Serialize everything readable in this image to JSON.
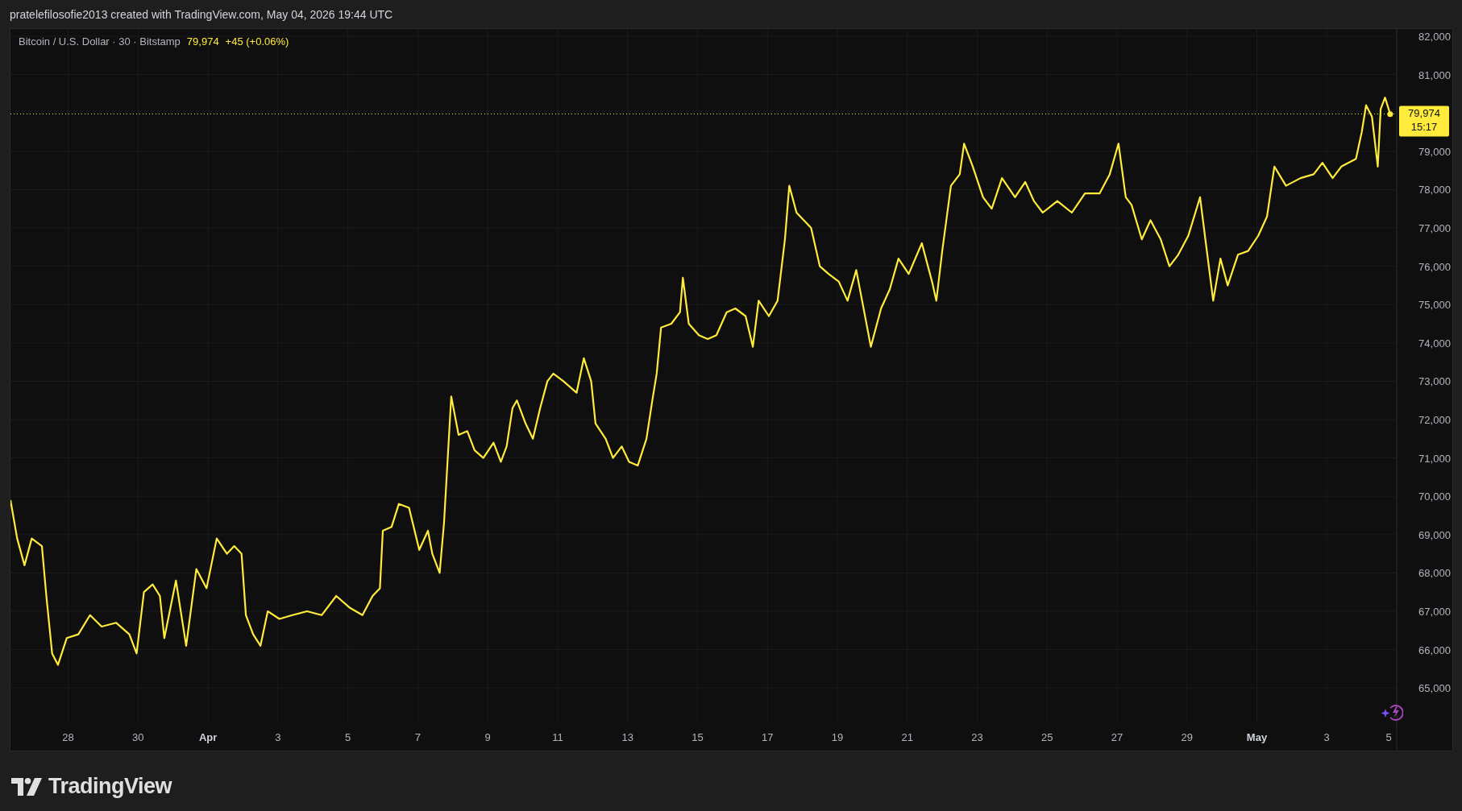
{
  "header": {
    "text": "pratelefilosofie2013 created with TradingView.com, May 04, 2026 19:44 UTC"
  },
  "legend": {
    "symbol": "Bitcoin / U.S. Dollar · 30 · Bitstamp",
    "price": "79,974",
    "change": "+45 (+0.06%)"
  },
  "price_tag": {
    "countdown": "15:17"
  },
  "chart_data": {
    "type": "line",
    "grid": true,
    "xlim": [
      "2026-03-26T08:24",
      "2026-05-05T00:00"
    ],
    "ylim": [
      64080,
      82189
    ],
    "ref_lines": [
      {
        "axis": "y",
        "value": 79974,
        "label": "79,974",
        "color": "#ffeb3b"
      }
    ],
    "yticks": [
      {
        "value": 65000,
        "label": "65,000"
      },
      {
        "value": 66000,
        "label": "66,000"
      },
      {
        "value": 67000,
        "label": "67,000"
      },
      {
        "value": 68000,
        "label": "68,000"
      },
      {
        "value": 69000,
        "label": "69,000"
      },
      {
        "value": 70000,
        "label": "70,000"
      },
      {
        "value": 71000,
        "label": "71,000"
      },
      {
        "value": 72000,
        "label": "72,000"
      },
      {
        "value": 73000,
        "label": "73,000"
      },
      {
        "value": 74000,
        "label": "74,000"
      },
      {
        "value": 75000,
        "label": "75,000"
      },
      {
        "value": 76000,
        "label": "76,000"
      },
      {
        "value": 77000,
        "label": "77,000"
      },
      {
        "value": 78000,
        "label": "78,000"
      },
      {
        "value": 79000,
        "label": "79,000"
      },
      {
        "value": 81000,
        "label": "81,000"
      },
      {
        "value": 82000,
        "label": "82,000"
      }
    ],
    "xticks": [
      {
        "value": "2026-03-28",
        "label": "28"
      },
      {
        "value": "2026-03-30",
        "label": "30"
      },
      {
        "value": "2026-04-01",
        "label": "Apr"
      },
      {
        "value": "2026-04-03",
        "label": "3"
      },
      {
        "value": "2026-04-05",
        "label": "5"
      },
      {
        "value": "2026-04-07",
        "label": "7"
      },
      {
        "value": "2026-04-09",
        "label": "9"
      },
      {
        "value": "2026-04-11",
        "label": "11"
      },
      {
        "value": "2026-04-13",
        "label": "13"
      },
      {
        "value": "2026-04-15",
        "label": "15"
      },
      {
        "value": "2026-04-17",
        "label": "17"
      },
      {
        "value": "2026-04-19",
        "label": "19"
      },
      {
        "value": "2026-04-21",
        "label": "21"
      },
      {
        "value": "2026-04-23",
        "label": "23"
      },
      {
        "value": "2026-04-25",
        "label": "25"
      },
      {
        "value": "2026-04-27",
        "label": "27"
      },
      {
        "value": "2026-04-29",
        "label": "29"
      },
      {
        "value": "2026-05-01",
        "label": "May"
      },
      {
        "value": "2026-05-03",
        "label": "3"
      },
      {
        "value": "2026-05-05",
        "label": "5"
      }
    ],
    "x": [
      "2026-03-26T08:24",
      "2026-03-26T13:00",
      "2026-03-26T18:00",
      "2026-03-26T23:00",
      "2026-03-27T06:00",
      "2026-03-27T09:00",
      "2026-03-27T13:00",
      "2026-03-27T17:00",
      "2026-03-27T23:00",
      "2026-03-28T07:00",
      "2026-03-28T15:00",
      "2026-03-28T23:00",
      "2026-03-29T09:00",
      "2026-03-29T18:00",
      "2026-03-29T23:00",
      "2026-03-30T04:00",
      "2026-03-30T10:00",
      "2026-03-30T15:00",
      "2026-03-30T18:00",
      "2026-03-31T02:00",
      "2026-03-31T09:00",
      "2026-03-31T16:00",
      "2026-03-31T23:00",
      "2026-04-01T06:00",
      "2026-04-01T13:00",
      "2026-04-01T18:00",
      "2026-04-01T23:00",
      "2026-04-02T02:00",
      "2026-04-02T07:00",
      "2026-04-02T12:00",
      "2026-04-02T17:00",
      "2026-04-03T01:00",
      "2026-04-03T10:00",
      "2026-04-03T20:00",
      "2026-04-04T06:00",
      "2026-04-04T16:00",
      "2026-04-05T01:00",
      "2026-04-05T10:00",
      "2026-04-05T17:00",
      "2026-04-05T22:00",
      "2026-04-06T00:00",
      "2026-04-06T06:00",
      "2026-04-06T11:00",
      "2026-04-06T18:00",
      "2026-04-07T01:00",
      "2026-04-07T07:00",
      "2026-04-07T10:00",
      "2026-04-07T15:00",
      "2026-04-07T18:00",
      "2026-04-07T23:00",
      "2026-04-08T04:00",
      "2026-04-08T10:00",
      "2026-04-08T15:00",
      "2026-04-08T21:00",
      "2026-04-09T04:00",
      "2026-04-09T09:00",
      "2026-04-09T13:00",
      "2026-04-09T17:00",
      "2026-04-09T20:00",
      "2026-04-10T02:00",
      "2026-04-10T07:00",
      "2026-04-10T12:00",
      "2026-04-10T17:00",
      "2026-04-10T21:00",
      "2026-04-11T04:00",
      "2026-04-11T13:00",
      "2026-04-11T18:00",
      "2026-04-11T23:00",
      "2026-04-12T02:00",
      "2026-04-12T09:00",
      "2026-04-12T14:00",
      "2026-04-12T20:00",
      "2026-04-13T01:00",
      "2026-04-13T07:00",
      "2026-04-13T13:00",
      "2026-04-13T17:00",
      "2026-04-13T20:00",
      "2026-04-13T23:00",
      "2026-04-14T06:00",
      "2026-04-14T12:00",
      "2026-04-14T14:00",
      "2026-04-14T18:00",
      "2026-04-15T01:00",
      "2026-04-15T07:00",
      "2026-04-15T13:00",
      "2026-04-15T20:00",
      "2026-04-16T02:00",
      "2026-04-16T09:00",
      "2026-04-16T14:00",
      "2026-04-16T18:00",
      "2026-04-17T01:00",
      "2026-04-17T07:00",
      "2026-04-17T12:00",
      "2026-04-17T15:00",
      "2026-04-17T20:00",
      "2026-04-18T06:00",
      "2026-04-18T12:00",
      "2026-04-18T18:00",
      "2026-04-19T01:00",
      "2026-04-19T07:00",
      "2026-04-19T13:00",
      "2026-04-19T18:00",
      "2026-04-19T23:00",
      "2026-04-20T06:00",
      "2026-04-20T12:00",
      "2026-04-20T18:00",
      "2026-04-21T01:00",
      "2026-04-21T10:00",
      "2026-04-21T17:00",
      "2026-04-21T20:00",
      "2026-04-22T00:00",
      "2026-04-22T06:00",
      "2026-04-22T12:00",
      "2026-04-22T15:00",
      "2026-04-22T21:00",
      "2026-04-23T04:00",
      "2026-04-23T10:00",
      "2026-04-23T17:00",
      "2026-04-24T02:00",
      "2026-04-24T09:00",
      "2026-04-24T15:00",
      "2026-04-24T21:00",
      "2026-04-25T07:00",
      "2026-04-25T17:00",
      "2026-04-26T02:00",
      "2026-04-26T12:00",
      "2026-04-26T19:00",
      "2026-04-27T01:00",
      "2026-04-27T06:00",
      "2026-04-27T10:00",
      "2026-04-27T17:00",
      "2026-04-27T23:00",
      "2026-04-28T06:00",
      "2026-04-28T12:00",
      "2026-04-28T18:00",
      "2026-04-29T01:00",
      "2026-04-29T09:00",
      "2026-04-29T13:00",
      "2026-04-29T18:00",
      "2026-04-29T23:00",
      "2026-04-30T04:00",
      "2026-04-30T11:00",
      "2026-04-30T18:00",
      "2026-05-01T01:00",
      "2026-05-01T07:00",
      "2026-05-01T12:00",
      "2026-05-01T20:00",
      "2026-05-02T06:00",
      "2026-05-02T15:00",
      "2026-05-02T21:00",
      "2026-05-03T04:00",
      "2026-05-03T10:00",
      "2026-05-03T20:00",
      "2026-05-04T00:00",
      "2026-05-04T03:00",
      "2026-05-04T07:00",
      "2026-05-04T11:00",
      "2026-05-04T13:00",
      "2026-05-04T16:00",
      "2026-05-04T19:30"
    ],
    "series": [
      {
        "color": "#ffeb3b",
        "values": [
          69900,
          68900,
          68200,
          68900,
          68700,
          67400,
          65900,
          65600,
          66300,
          66400,
          66900,
          66600,
          66700,
          66400,
          65900,
          67500,
          67700,
          67400,
          66300,
          67800,
          66100,
          68100,
          67600,
          68900,
          68500,
          68700,
          68500,
          66900,
          66400,
          66100,
          67000,
          66800,
          66900,
          67000,
          66900,
          67400,
          67100,
          66900,
          67400,
          67600,
          69100,
          69200,
          69800,
          69700,
          68600,
          69100,
          68500,
          68000,
          69300,
          72600,
          71600,
          71700,
          71200,
          71000,
          71400,
          70900,
          71300,
          72300,
          72500,
          71900,
          71500,
          72300,
          73000,
          73200,
          73000,
          72700,
          73600,
          73000,
          71900,
          71500,
          71000,
          71300,
          70900,
          70800,
          71500,
          72500,
          73200,
          74400,
          74500,
          74800,
          75700,
          74500,
          74200,
          74100,
          74200,
          74800,
          74900,
          74700,
          73900,
          75100,
          74700,
          75100,
          76700,
          78100,
          77400,
          77000,
          76000,
          75800,
          75600,
          75100,
          75900,
          74900,
          73900,
          74900,
          75400,
          76200,
          75800,
          76600,
          75600,
          75100,
          76400,
          78100,
          78400,
          79200,
          78600,
          77800,
          77500,
          78300,
          77800,
          78200,
          77700,
          77400,
          77700,
          77400,
          77900,
          77900,
          78400,
          79200,
          77800,
          77600,
          76700,
          77200,
          76700,
          76000,
          76300,
          76800,
          77800,
          76600,
          75100,
          76200,
          75500,
          76300,
          76400,
          76800,
          77300,
          78600,
          78100,
          78300,
          78400,
          78700,
          78300,
          78600,
          78800,
          79500,
          80200,
          79900,
          78600,
          80100,
          80400,
          79970
        ]
      }
    ]
  },
  "logo": {
    "text": "TradingView"
  }
}
